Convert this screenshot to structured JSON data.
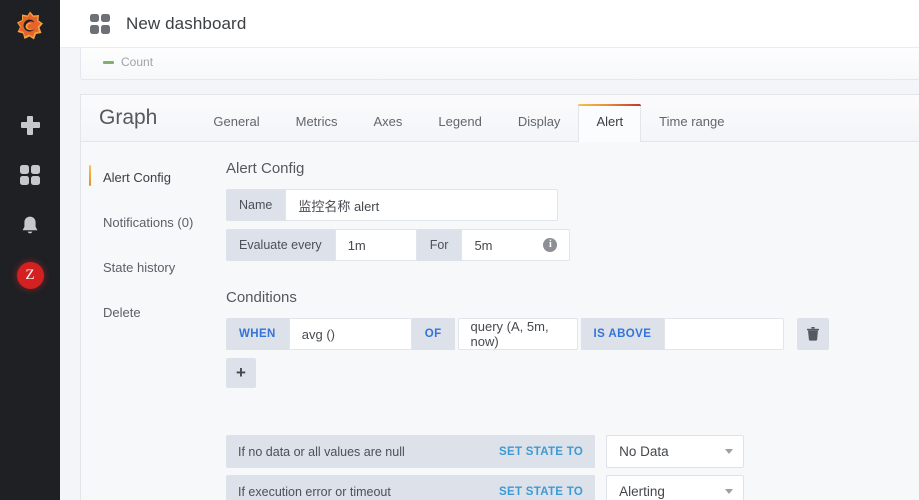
{
  "rail": {
    "logo_name": "grafana-logo",
    "items": [
      {
        "name": "add-panel",
        "icon": "plus-icon"
      },
      {
        "name": "dashboards",
        "icon": "grid-icon"
      },
      {
        "name": "alerting",
        "icon": "bell-icon"
      }
    ],
    "avatar_label": "Z"
  },
  "topbar": {
    "icon": "grid-icon",
    "title": "New dashboard"
  },
  "graph_panel": {
    "legend": [
      {
        "label": "Count",
        "color": "#7eb26d"
      }
    ]
  },
  "editor": {
    "heading": "Graph",
    "tabs": [
      {
        "label": "General",
        "active": false
      },
      {
        "label": "Metrics",
        "active": false
      },
      {
        "label": "Axes",
        "active": false
      },
      {
        "label": "Legend",
        "active": false
      },
      {
        "label": "Display",
        "active": false
      },
      {
        "label": "Alert",
        "active": true
      },
      {
        "label": "Time range",
        "active": false
      }
    ],
    "side_nav": [
      {
        "label": "Alert Config",
        "active": true
      },
      {
        "label": "Notifications (0)",
        "active": false
      },
      {
        "label": "State history",
        "active": false
      },
      {
        "label": "Delete",
        "active": false
      }
    ],
    "alert_config": {
      "section_title": "Alert Config",
      "name_label": "Name",
      "name_value": "监控名称 alert",
      "name_placeholder": "",
      "evaluate_label": "Evaluate every",
      "evaluate_value": "1m",
      "for_label": "For",
      "for_value": "5m",
      "info_icon": "info-icon"
    },
    "conditions": {
      "section_title": "Conditions",
      "rows": [
        {
          "when_label": "WHEN",
          "reducer_value": "avg ()",
          "of_label": "OF",
          "query_value": "query (A, 5m, now)",
          "evaluator_label": "IS ABOVE",
          "threshold_value": "",
          "threshold_placeholder": "",
          "delete_icon": "trash-icon"
        }
      ],
      "add_label": "+"
    },
    "handling": {
      "rows": [
        {
          "label": "If no data or all values are null",
          "set_state_label": "SET STATE TO",
          "value": "No Data"
        },
        {
          "label": "If execution error or timeout",
          "set_state_label": "SET STATE TO",
          "value": "Alerting"
        }
      ]
    }
  },
  "colors": {
    "accent_orange": "#e08c3b",
    "link_blue": "#3274d9",
    "set_state_blue": "#3d9bd4",
    "rail_bg": "#1f2024",
    "avatar_red": "#d32020",
    "legend_green": "#7eb26d"
  }
}
